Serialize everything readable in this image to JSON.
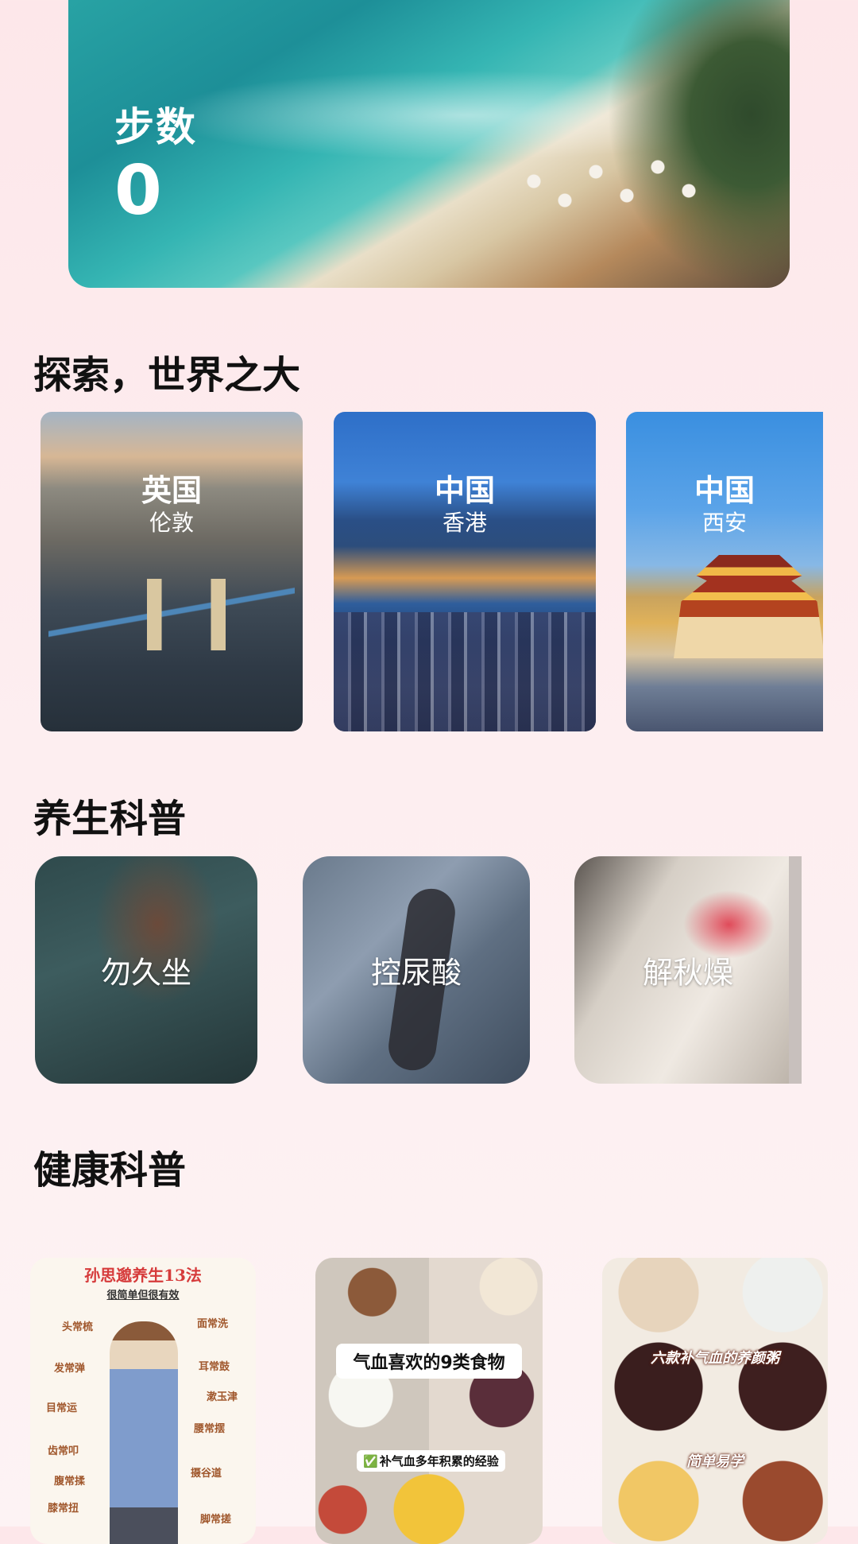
{
  "hero": {
    "label": "步数",
    "value": "0"
  },
  "explore": {
    "title": "探索，世界之大",
    "cards": [
      {
        "country": "英国",
        "city": "伦敦"
      },
      {
        "country": "中国",
        "city": "香港"
      },
      {
        "country": "中国",
        "city": "西安"
      }
    ]
  },
  "wellness": {
    "title": "养生科普",
    "cards": [
      {
        "label": "勿久坐"
      },
      {
        "label": "控尿酸"
      },
      {
        "label": "解秋燥"
      }
    ]
  },
  "health": {
    "title": "健康科普",
    "cards": [
      {
        "title": "孙思邈养生13法",
        "subtitle": "很简单但很有效",
        "terms": [
          "头常梳",
          "面常洗",
          "发常弹",
          "耳常鼓",
          "目常运",
          "漱玉津",
          "齿常叩",
          "腰常摆",
          "腹常揉",
          "摄谷道",
          "膝常扭",
          "脚常搓"
        ]
      },
      {
        "banner": "气血喜欢的9类食物",
        "tag": "补气血多年积累的经验",
        "check": "✅"
      },
      {
        "overlay_top": "六款补气血的养颜粥",
        "overlay_bottom": "简单易学"
      }
    ]
  }
}
